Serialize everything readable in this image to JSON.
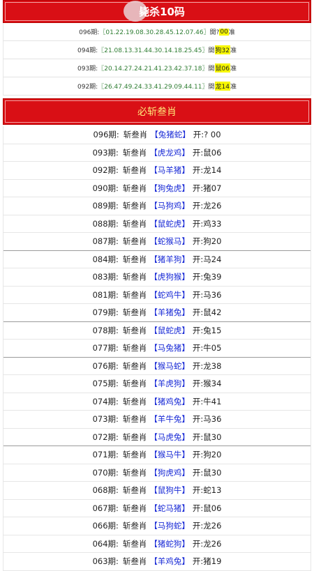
{
  "header": {
    "title": "毙杀10码"
  },
  "top_rows": [
    {
      "period": "096期:",
      "nums": "〖01.22.19.08.30.28.45.12.07.46〗",
      "open": "開?",
      "hl": "00",
      "tail": "准"
    },
    {
      "period": "094期:",
      "nums": "〖21.08.13.31.44.30.14.18.25.45〗",
      "open": "開",
      "hl": "狗32",
      "tail": "准"
    },
    {
      "period": "093期:",
      "nums": "〖20.14.27.24.21.41.23.42.37.18〗",
      "open": "開",
      "hl": "鼠06",
      "tail": "准"
    },
    {
      "period": "092期:",
      "nums": "〖26.47.49.24.33.41.29.09.44.11〗",
      "open": "開",
      "hl": "龙14",
      "tail": "准"
    }
  ],
  "section2": {
    "title": "必斩叁肖"
  },
  "rows": [
    {
      "period": "096期:",
      "label": "斩叁肖",
      "zodiac": "【兔猪蛇】",
      "open": "开:? 00",
      "thick": false
    },
    {
      "period": "093期:",
      "label": "斩叁肖",
      "zodiac": "【虎龙鸡】",
      "open": "开:鼠06",
      "thick": false
    },
    {
      "period": "092期:",
      "label": "斩叁肖",
      "zodiac": "【马羊猪】",
      "open": "开:龙14",
      "thick": false
    },
    {
      "period": "090期:",
      "label": "斩叁肖",
      "zodiac": "【狗兔虎】",
      "open": "开:猪07",
      "thick": false
    },
    {
      "period": "089期:",
      "label": "斩叁肖",
      "zodiac": "【马狗鸡】",
      "open": "开:龙26",
      "thick": false
    },
    {
      "period": "088期:",
      "label": "斩叁肖",
      "zodiac": "【鼠蛇虎】",
      "open": "开:鸡33",
      "thick": false
    },
    {
      "period": "087期:",
      "label": "斩叁肖",
      "zodiac": "【蛇猴马】",
      "open": "开:狗20",
      "thick": true
    },
    {
      "period": "084期:",
      "label": "斩叁肖",
      "zodiac": "【猪羊狗】",
      "open": "开:马24",
      "thick": false
    },
    {
      "period": "083期:",
      "label": "斩叁肖",
      "zodiac": "【虎狗猴】",
      "open": "开:兔39",
      "thick": false
    },
    {
      "period": "081期:",
      "label": "斩叁肖",
      "zodiac": "【蛇鸡牛】",
      "open": "开:马36",
      "thick": false
    },
    {
      "period": "079期:",
      "label": "斩叁肖",
      "zodiac": "【羊猪兔】",
      "open": "开:鼠42",
      "thick": true
    },
    {
      "period": "078期:",
      "label": "斩叁肖",
      "zodiac": "【鼠蛇虎】",
      "open": "开:兔15",
      "thick": false
    },
    {
      "period": "077期:",
      "label": "斩叁肖",
      "zodiac": "【马兔猪】",
      "open": "开:牛05",
      "thick": true
    },
    {
      "period": "076期:",
      "label": "斩叁肖",
      "zodiac": "【猴马蛇】",
      "open": "开:龙38",
      "thick": false
    },
    {
      "period": "075期:",
      "label": "斩叁肖",
      "zodiac": "【羊虎狗】",
      "open": "开:猴34",
      "thick": false
    },
    {
      "period": "074期:",
      "label": "斩叁肖",
      "zodiac": "【猪鸡兔】",
      "open": "开:牛41",
      "thick": false
    },
    {
      "period": "073期:",
      "label": "斩叁肖",
      "zodiac": "【羊牛兔】",
      "open": "开:马36",
      "thick": false
    },
    {
      "period": "072期:",
      "label": "斩叁肖",
      "zodiac": "【马虎兔】",
      "open": "开:鼠30",
      "thick": true
    },
    {
      "period": "071期:",
      "label": "斩叁肖",
      "zodiac": "【猴马牛】",
      "open": "开:狗20",
      "thick": false
    },
    {
      "period": "070期:",
      "label": "斩叁肖",
      "zodiac": "【狗虎鸡】",
      "open": "开:鼠30",
      "thick": false
    },
    {
      "period": "068期:",
      "label": "斩叁肖",
      "zodiac": "【鼠狗牛】",
      "open": "开:蛇13",
      "thick": false
    },
    {
      "period": "067期:",
      "label": "斩叁肖",
      "zodiac": "【蛇马猪】",
      "open": "开:鼠06",
      "thick": false
    },
    {
      "period": "066期:",
      "label": "斩叁肖",
      "zodiac": "【马狗蛇】",
      "open": "开:龙26",
      "thick": false
    },
    {
      "period": "064期:",
      "label": "斩叁肖",
      "zodiac": "【猪蛇狗】",
      "open": "开:龙26",
      "thick": false
    },
    {
      "period": "063期:",
      "label": "斩叁肖",
      "zodiac": "【羊鸡兔】",
      "open": "开:猪19",
      "thick": false
    }
  ]
}
